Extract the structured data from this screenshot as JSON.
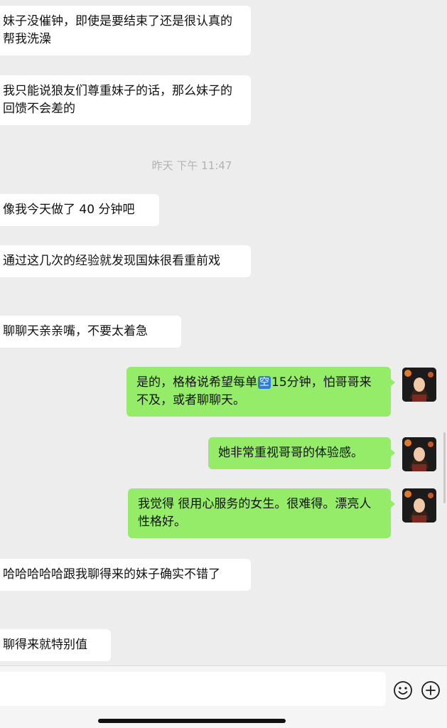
{
  "messages": [
    {
      "side": "left",
      "text": "妹子没催钟，即使是要结束了还是很认真的帮我洗澡"
    },
    {
      "side": "left",
      "text": "我只能说狼友们尊重妹子的话，那么妹子的回馈不会差的"
    },
    {
      "side": "left",
      "text": "像我今天做了 40 分钟吧"
    },
    {
      "side": "left",
      "text": "通过这几次的经验就发现国妹很看重前戏"
    },
    {
      "side": "left",
      "text": "聊聊天亲亲嘴，不要太着急"
    },
    {
      "side": "right",
      "text_before": "是的，格格说希望每单",
      "badge": "空",
      "text_after": "15分钟，怕哥哥来不及，或者聊聊天。"
    },
    {
      "side": "right",
      "text": "她非常重视哥哥的体验感。"
    },
    {
      "side": "right",
      "text": "我觉得 很用心服务的女生。很难得。漂亮人性格好。"
    },
    {
      "side": "left",
      "text": "哈哈哈哈哈跟我聊得来的妹子确实不错了"
    },
    {
      "side": "left",
      "text": "聊得来就特别值"
    }
  ],
  "timestamp": "昨天 下午 11:47",
  "input_bar": {
    "emoji_icon": "smiley-face-icon",
    "plus_icon": "plus-circle-icon"
  },
  "colors": {
    "background": "#ededed",
    "left_bubble": "#ffffff",
    "right_bubble": "#95ec69",
    "timestamp": "#b2b2b2"
  }
}
